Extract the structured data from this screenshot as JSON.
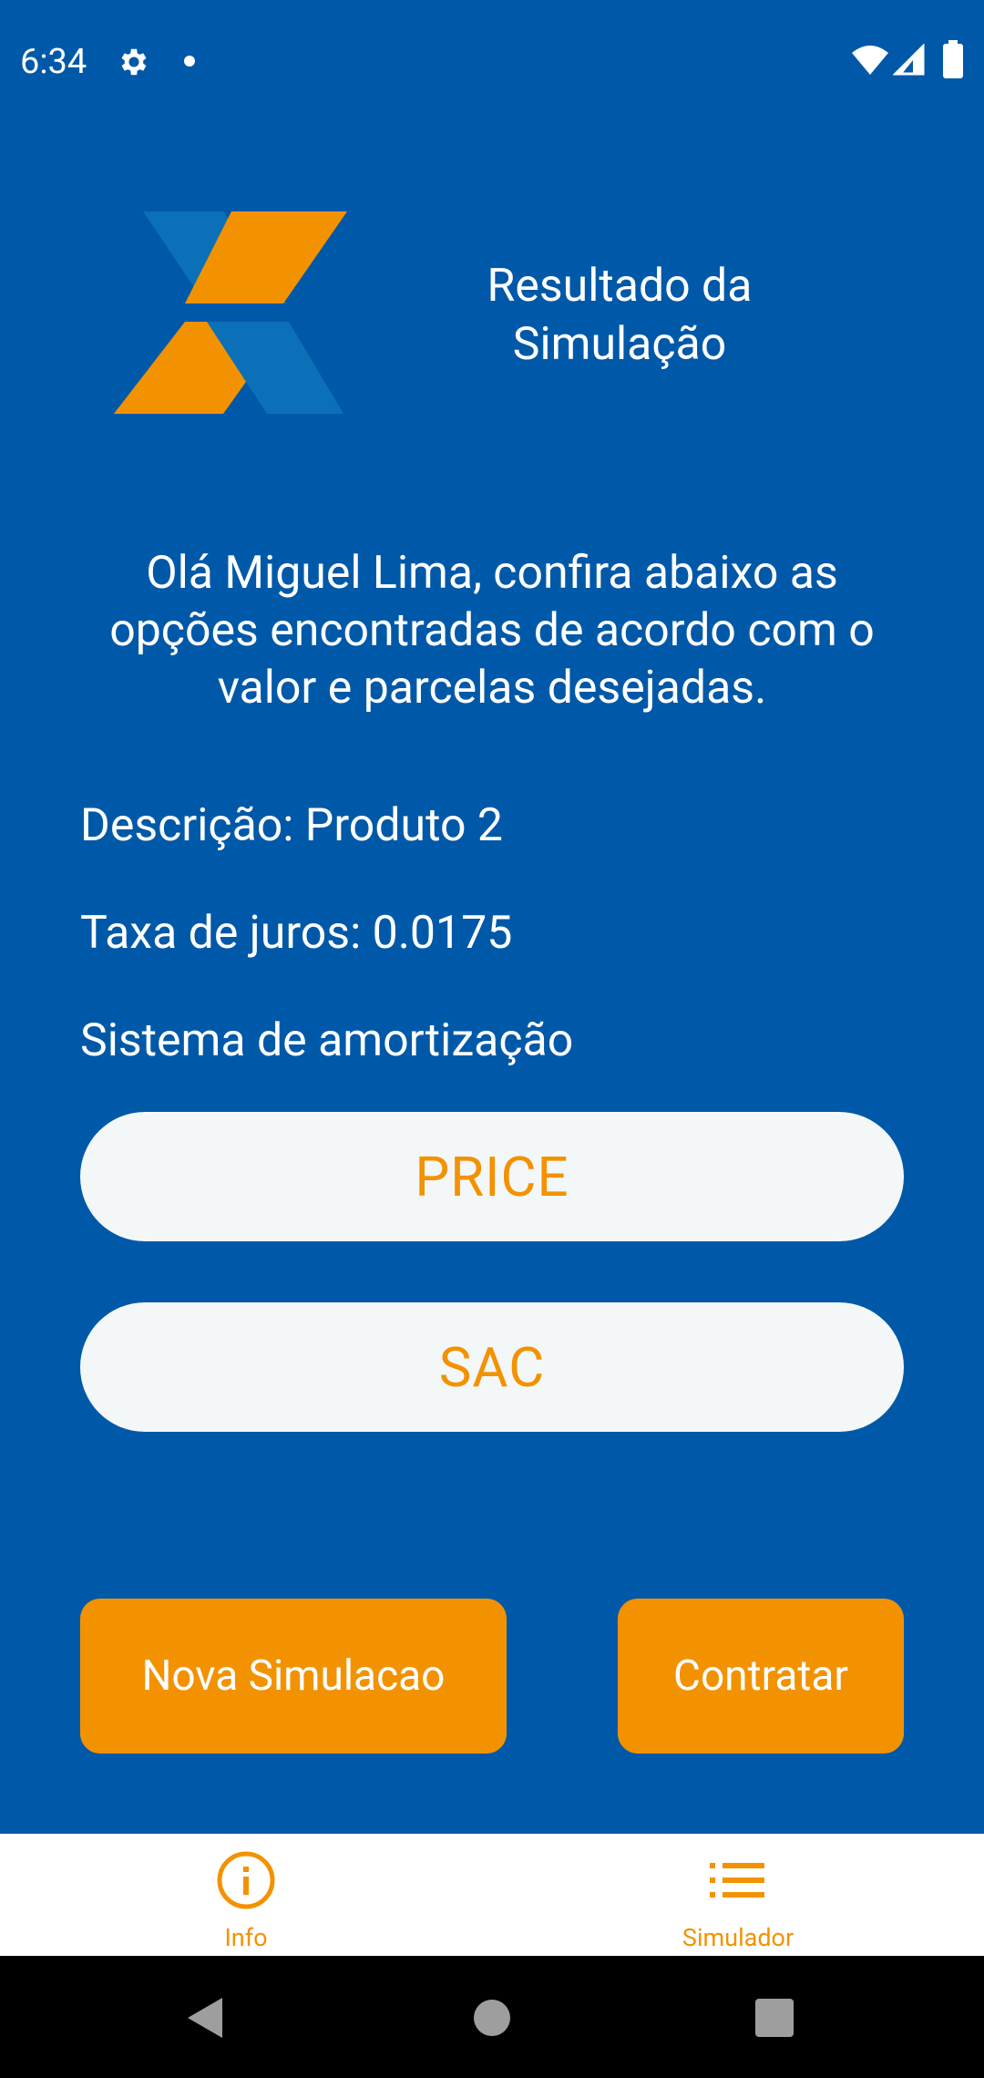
{
  "status_bar": {
    "time": "6:34",
    "icons": [
      "gear-icon",
      "notification-dot",
      "wifi-icon",
      "cell-signal-icon",
      "battery-icon"
    ]
  },
  "header": {
    "logo": "caixa-x-logo",
    "title": "Resultado da Simulação"
  },
  "greeting": "Olá Miguel Lima, confira abaixo as opções encontradas de acordo com o valor e parcelas desejadas.",
  "details": {
    "description": "Descrição: Produto 2",
    "interest_rate": "Taxa de juros: 0.0175",
    "amortization_label": "Sistema de amortização"
  },
  "amortization_options": [
    "PRICE",
    "SAC"
  ],
  "actions": {
    "new_simulation": "Nova Simulacao",
    "contract": "Contratar"
  },
  "bottom_nav": [
    {
      "label": "Info",
      "icon": "info-icon"
    },
    {
      "label": "Simulador",
      "icon": "list-icon"
    }
  ],
  "colors": {
    "background": "#0059A8",
    "accent": "#F39200",
    "logo_blue": "#0B70B8",
    "logo_orange": "#F39200",
    "option_button": "#F4F7F8"
  }
}
